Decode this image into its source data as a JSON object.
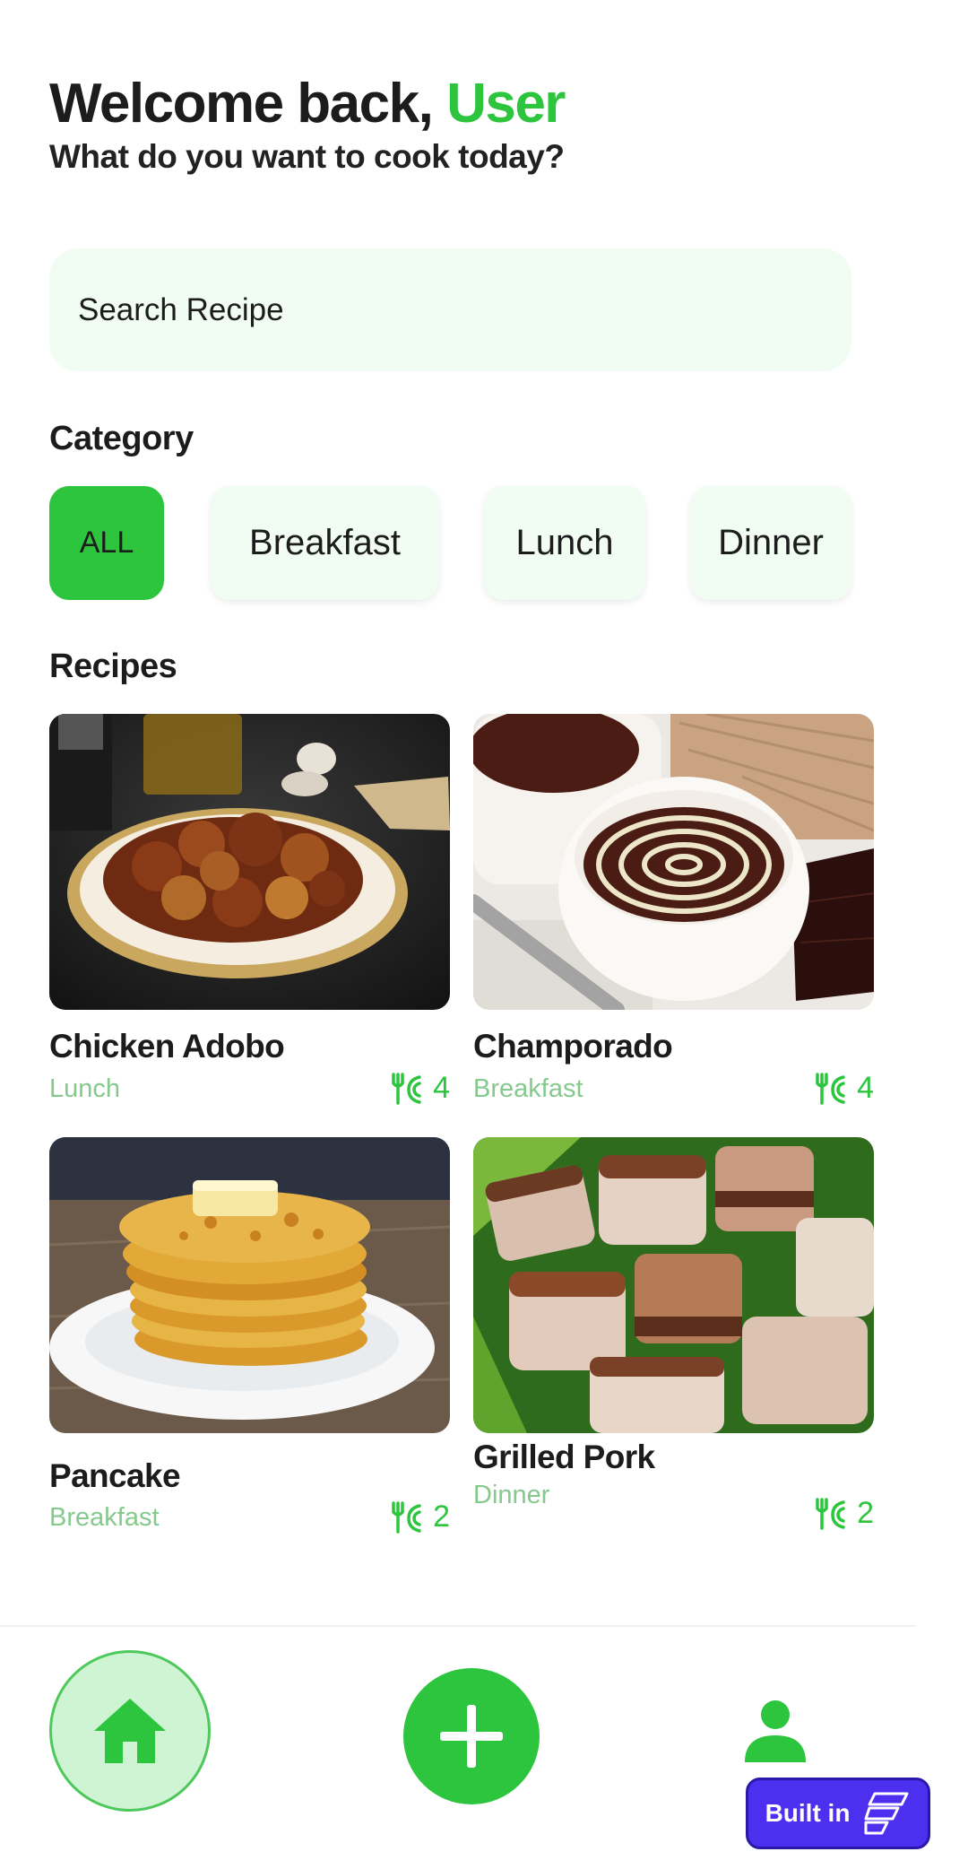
{
  "header": {
    "welcome_prefix": "Welcome back, ",
    "user_name": "User",
    "subtitle": "What do you want to cook today?"
  },
  "search": {
    "placeholder": "Search Recipe"
  },
  "category": {
    "title": "Category",
    "chips": [
      "ALL",
      "Breakfast",
      "Lunch",
      "Dinner"
    ],
    "active": "ALL"
  },
  "recipes": {
    "title": "Recipes",
    "items": [
      {
        "name": "Chicken Adobo",
        "category": "Lunch",
        "servings": "4"
      },
      {
        "name": "Champorado",
        "category": "Breakfast",
        "servings": "4"
      },
      {
        "name": "Pancake",
        "category": "Breakfast",
        "servings": "2"
      },
      {
        "name": "Grilled Pork",
        "category": "Dinner",
        "servings": "2"
      }
    ]
  },
  "nav": {
    "items": [
      "home-icon",
      "add-icon",
      "profile-icon"
    ],
    "active": "home-icon"
  },
  "badge": {
    "label": "Built in"
  },
  "colors": {
    "accent": "#2dc53e",
    "chip_bg": "#f1fdf2",
    "badge_bg": "#4d2ff0"
  }
}
